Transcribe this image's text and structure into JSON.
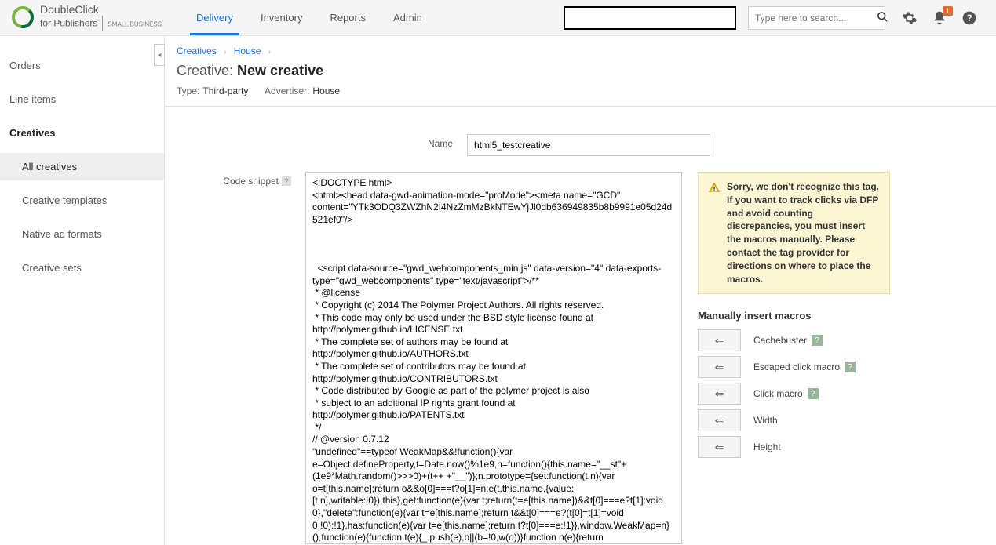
{
  "header": {
    "product_name1": "DoubleClick",
    "product_name2": "for Publishers",
    "product_edition": "SMALL BUSINESS",
    "nav": [
      "Delivery",
      "Inventory",
      "Reports",
      "Admin"
    ],
    "search_placeholder": "Type here to search...",
    "notif_count": "1"
  },
  "sidebar": {
    "items": [
      "Orders",
      "Line items",
      "Creatives"
    ],
    "sub_items": [
      "All creatives",
      "Creative templates",
      "Native ad formats",
      "Creative sets"
    ]
  },
  "breadcrumb": [
    "Creatives",
    "House"
  ],
  "page": {
    "title_prefix": "Creative: ",
    "title": "New creative",
    "type_label": "Type:",
    "type_value": "Third-party",
    "advertiser_label": "Advertiser:",
    "advertiser_value": "House"
  },
  "form": {
    "name_label": "Name",
    "name_value": "html5_testcreative",
    "code_label": "Code snippet",
    "code_snippet": "<!DOCTYPE html>\n<html><head data-gwd-animation-mode=\"proMode\"><meta name=\"GCD\" content=\"YTk3ODQ3ZWZhN2I4NzZmMzBkNTEwYjJl0db636949835b8b9991e05d24d521ef0\"/>\n\n\n\n  <script data-source=\"gwd_webcomponents_min.js\" data-version=\"4\" data-exports-type=\"gwd_webcomponents\" type=\"text/javascript\">/**\n * @license\n * Copyright (c) 2014 The Polymer Project Authors. All rights reserved.\n * This code may only be used under the BSD style license found at\nhttp://polymer.github.io/LICENSE.txt\n * The complete set of authors may be found at\nhttp://polymer.github.io/AUTHORS.txt\n * The complete set of contributors may be found at\nhttp://polymer.github.io/CONTRIBUTORS.txt\n * Code distributed by Google as part of the polymer project is also\n * subject to an additional IP rights grant found at\nhttp://polymer.github.io/PATENTS.txt\n */\n// @version 0.7.12\n\"undefined\"==typeof WeakMap&&!function(){var e=Object.defineProperty,t=Date.now()%1e9,n=function(){this.name=\"__st\"+(1e9*Math.random()>>>0)+(t++ +\"__\")};n.prototype={set:function(t,n){var o=t[this.name];return o&&o[0]===t?o[1]=n:e(t,this.name,{value:[t,n],writable:!0}),this},get:function(e){var t;return(t=e[this.name])&&t[0]===e?t[1]:void 0},\"delete\":function(e){var t=e[this.name];return t&&t[0]===e?(t[0]=t[1]=void 0,!0):!1},has:function(e){var t=e[this.name];return t?t[0]===e:!1}},window.WeakMap=n}(),function(e){function t(e){_.push(e),b||(b=!0,w(o))}function n(e){return"
  },
  "warning": "Sorry, we don't recognize this tag. If you want to track clicks via DFP and avoid counting discrepancies, you must insert the macros manually. Please contact the tag provider for directions on where to place the macros.",
  "macros": {
    "title": "Manually insert macros",
    "items": [
      {
        "label": "Cachebuster",
        "help": true
      },
      {
        "label": "Escaped click macro",
        "help": true
      },
      {
        "label": "Click macro",
        "help": true
      },
      {
        "label": "Width",
        "help": false
      },
      {
        "label": "Height",
        "help": false
      }
    ]
  }
}
